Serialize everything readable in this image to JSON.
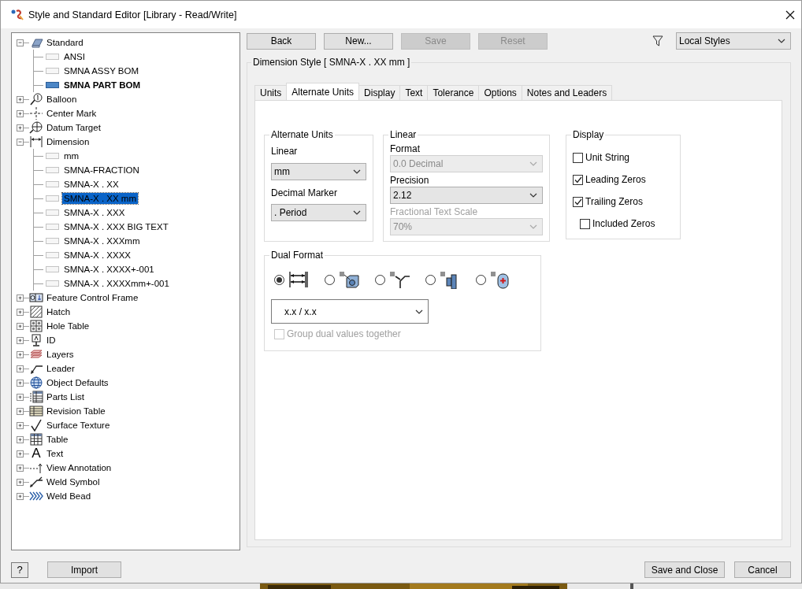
{
  "window": {
    "title": "Style and Standard Editor [Library - Read/Write]"
  },
  "tree": [
    {
      "label": "Standard",
      "kind": "standard",
      "expanded": true,
      "children": [
        {
          "label": "ANSI",
          "selected": false,
          "active": false
        },
        {
          "label": "SMNA ASSY BOM",
          "selected": false,
          "active": false
        },
        {
          "label": "SMNA PART BOM",
          "selected": false,
          "active": true
        }
      ]
    },
    {
      "label": "Balloon",
      "kind": "balloon",
      "expanded": false
    },
    {
      "label": "Center Mark",
      "kind": "center-mark",
      "expanded": false
    },
    {
      "label": "Datum Target",
      "kind": "datum",
      "expanded": false
    },
    {
      "label": "Dimension",
      "kind": "dimension",
      "expanded": true,
      "children": [
        {
          "label": "mm",
          "selected": false,
          "active": false
        },
        {
          "label": "SMNA-FRACTION",
          "selected": false,
          "active": false
        },
        {
          "label": "SMNA-X . XX",
          "selected": false,
          "active": false
        },
        {
          "label": "SMNA-X . XX mm",
          "selected": true,
          "active": false
        },
        {
          "label": "SMNA-X . XXX",
          "selected": false,
          "active": false
        },
        {
          "label": "SMNA-X . XXX BIG TEXT",
          "selected": false,
          "active": false
        },
        {
          "label": "SMNA-X . XXXmm",
          "selected": false,
          "active": false
        },
        {
          "label": "SMNA-X . XXXX",
          "selected": false,
          "active": false
        },
        {
          "label": "SMNA-X . XXXX+-001",
          "selected": false,
          "active": false
        },
        {
          "label": "SMNA-X . XXXXmm+-001",
          "selected": false,
          "active": false
        }
      ]
    },
    {
      "label": "Feature Control Frame",
      "kind": "fcf",
      "expanded": false
    },
    {
      "label": "Hatch",
      "kind": "hatch",
      "expanded": false
    },
    {
      "label": "Hole Table",
      "kind": "hole-table",
      "expanded": false
    },
    {
      "label": "ID",
      "kind": "id",
      "expanded": false
    },
    {
      "label": "Layers",
      "kind": "layers",
      "expanded": false
    },
    {
      "label": "Leader",
      "kind": "leader",
      "expanded": false
    },
    {
      "label": "Object Defaults",
      "kind": "globe",
      "expanded": false
    },
    {
      "label": "Parts List",
      "kind": "parts-list",
      "expanded": false
    },
    {
      "label": "Revision Table",
      "kind": "revision-table",
      "expanded": false
    },
    {
      "label": "Surface Texture",
      "kind": "surface",
      "expanded": false
    },
    {
      "label": "Table",
      "kind": "table",
      "expanded": false
    },
    {
      "label": "Text",
      "kind": "text",
      "glyph": "A",
      "expanded": false
    },
    {
      "label": "View Annotation",
      "kind": "view-annotation",
      "expanded": false
    },
    {
      "label": "Weld Symbol",
      "kind": "weld-symbol",
      "expanded": false
    },
    {
      "label": "Weld Bead",
      "kind": "weld-bead",
      "expanded": false
    }
  ],
  "toolbar": [
    {
      "label": "Back",
      "disabled": false
    },
    {
      "label": "New...",
      "disabled": false
    },
    {
      "label": "Save",
      "disabled": true
    },
    {
      "label": "Reset",
      "disabled": true
    }
  ],
  "filter": {
    "value": "Local Styles"
  },
  "style_group": {
    "title": "Dimension Style [ SMNA-X . XX mm ]"
  },
  "tabs": [
    {
      "label": "Units",
      "selected": false
    },
    {
      "label": "Alternate Units",
      "selected": true
    },
    {
      "label": "Display",
      "selected": false
    },
    {
      "label": "Text",
      "selected": false
    },
    {
      "label": "Tolerance",
      "selected": false
    },
    {
      "label": "Options",
      "selected": false
    },
    {
      "label": "Notes and Leaders",
      "selected": false
    }
  ],
  "alternate_units": {
    "title": "Alternate Units",
    "linear_label": "Linear",
    "linear_value": "mm",
    "decimal_label": "Decimal Marker",
    "decimal_value": ". Period"
  },
  "linear": {
    "title": "Linear",
    "format_label": "Format",
    "format_value": "0.0 Decimal",
    "format_disabled": true,
    "precision_label": "Precision",
    "precision_value": "2.12",
    "scale_label": "Fractional Text Scale",
    "scale_value": "70%",
    "scale_disabled": true
  },
  "display": {
    "title": "Display",
    "options": [
      {
        "label": "Unit String",
        "checked": false
      },
      {
        "label": "Leading Zeros",
        "checked": true
      },
      {
        "label": "Trailing Zeros",
        "checked": true,
        "children": [
          {
            "label": "Included Zeros",
            "checked": false
          }
        ]
      }
    ]
  },
  "dual_format": {
    "title": "Dual Format",
    "options": [
      {
        "kind": "linear",
        "selected": true
      },
      {
        "kind": "block",
        "selected": false
      },
      {
        "kind": "bend",
        "selected": false
      },
      {
        "kind": "part",
        "selected": false
      },
      {
        "kind": "capsule",
        "selected": false
      }
    ],
    "format_value": "x.x / x.x",
    "group": {
      "label": "Group dual values together",
      "checked": false,
      "disabled": true
    }
  },
  "footer": {
    "help": "?",
    "import": "Import",
    "save_close": "Save and Close",
    "cancel": "Cancel"
  }
}
